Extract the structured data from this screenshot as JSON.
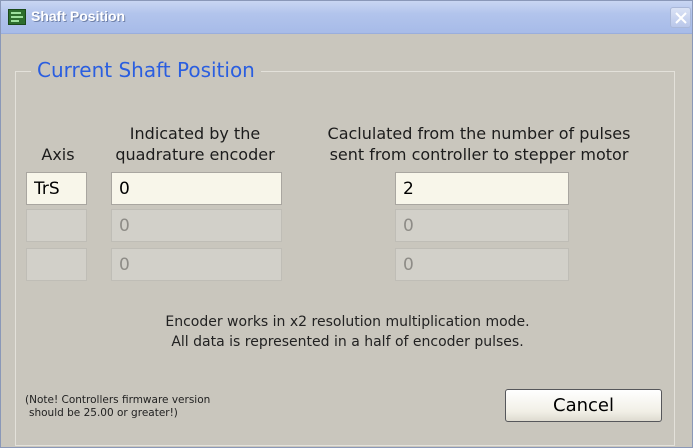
{
  "window": {
    "title": "Shaft Position",
    "close_icon": "close-icon"
  },
  "group": {
    "legend": "Current Shaft Position"
  },
  "headers": {
    "axis": "Axis",
    "encoder_line1": "Indicated by the",
    "encoder_line2": "quadrature encoder",
    "pulses_line1": "Caclulated from the number of pulses",
    "pulses_line2": "sent from controller to stepper motor"
  },
  "rows": [
    {
      "axis": "TrS",
      "encoder": "0",
      "pulses": "2",
      "enabled": true
    },
    {
      "axis": "",
      "encoder": "0",
      "pulses": "0",
      "enabled": false
    },
    {
      "axis": "",
      "encoder": "0",
      "pulses": "0",
      "enabled": false
    }
  ],
  "info": {
    "line1": "Encoder works in x2 resolution multiplication mode.",
    "line2": "All data is represented in a half of encoder pulses."
  },
  "note": {
    "line1": "(Note! Controllers firmware version",
    "line2": "should be 25.00 or greater!)"
  },
  "buttons": {
    "cancel": "Cancel"
  },
  "colors": {
    "legend": "#2a5ee0",
    "window_bg": "#c9c6bd",
    "titlebar": "#b2c4ec"
  }
}
